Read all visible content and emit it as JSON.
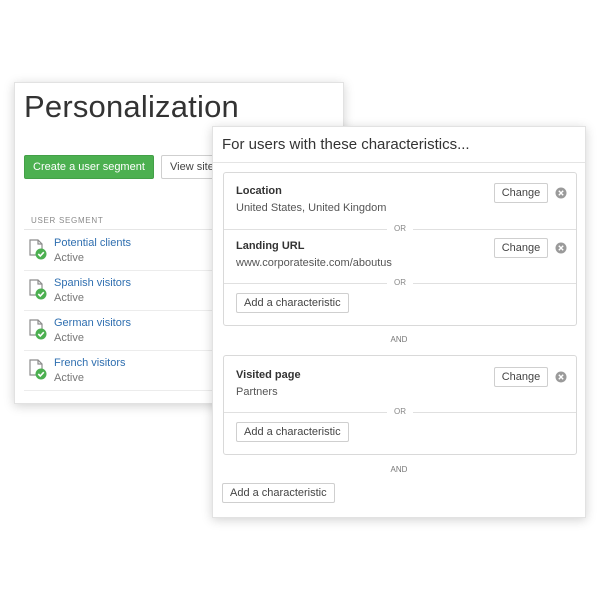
{
  "personalization": {
    "title": "Personalization",
    "create_segment_button": "Create a user segment",
    "view_site_button": "View site",
    "column_header": "USER SEGMENT",
    "segments": [
      {
        "name": "Potential clients",
        "status": "Active"
      },
      {
        "name": "Spanish visitors",
        "status": "Active"
      },
      {
        "name": "German visitors",
        "status": "Active"
      },
      {
        "name": "French visitors",
        "status": "Active"
      }
    ]
  },
  "characteristics": {
    "title": "For users with these characteristics...",
    "groups": [
      {
        "items": [
          {
            "label": "Location",
            "value": "United States, United Kingdom",
            "change_label": "Change"
          },
          {
            "label": "Landing URL",
            "value": "www.corporatesite.com/aboutus",
            "change_label": "Change"
          }
        ],
        "or_label": "OR",
        "add_label": "Add a characteristic"
      },
      {
        "items": [
          {
            "label": "Visited page",
            "value": "Partners",
            "change_label": "Change"
          }
        ],
        "or_label": "OR",
        "add_label": "Add a characteristic"
      }
    ],
    "and_label": "AND",
    "add_label": "Add a characteristic"
  },
  "icons": {
    "segment_icon": "document-check-icon",
    "remove_icon": "remove-circle-icon"
  },
  "colors": {
    "primary_green": "#4cb050",
    "link_blue": "#2f6fb0",
    "check_green": "#4cb050",
    "remove_gray": "#9a9a9a"
  }
}
